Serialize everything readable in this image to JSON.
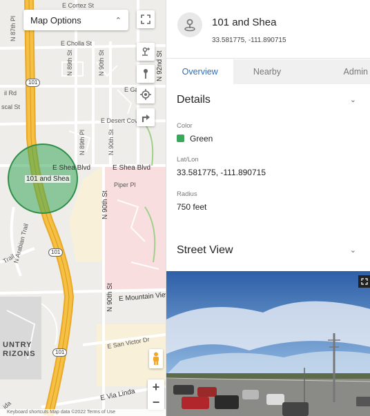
{
  "map": {
    "options_label": "Map Options",
    "roads": {
      "e_cortez_st": "E Cortez St",
      "n_87th_pl": "N 87th Pl",
      "e_cholla_st": "E Cholla St",
      "n_89th_st": "N 89th St",
      "n_90th_st": "N 90th St",
      "n_92nd_st": "N 92nd St",
      "e_ga": "E Ga",
      "il_rd": "il Rd",
      "scal_st": "scal St",
      "e_desert_cove": "E Desert Cove",
      "n_89th_pl": "N 89th Pl",
      "n_90th_st_2": "N 90th St",
      "e_shea_blvd_1": "E Shea Blvd",
      "e_shea_blvd_2": "E Shea Blvd",
      "piper_pl": "Piper Pl",
      "n_90th_st_3": "N 90th St",
      "n_arabian_trail": "N Arabian Trail",
      "trail": "Trail",
      "n_90th_st_4": "N 90th St",
      "e_mountain_view": "E Mountain View",
      "e_san_victor_dr": "E San Victor Dr",
      "e_via_linda": "E Via Linda",
      "ida": "ida"
    },
    "shields": {
      "s1": "101",
      "s2": "101",
      "s3": "101"
    },
    "area_label": [
      "UNTRY",
      "RIZONS"
    ],
    "pin_label": "101 and Shea",
    "footer": "Keyboard shortcuts    Map data ©2022    Terms of Use",
    "colors": {
      "circle": "#3aa85a",
      "freeway": "#f5c043",
      "residential": "#f8d7d7",
      "park": "#cfe7c4"
    }
  },
  "location": {
    "title": "101 and Shea",
    "coords": "33.581775, -111.890715"
  },
  "tabs": [
    {
      "label": "Overview",
      "active": true
    },
    {
      "label": "Nearby",
      "active": false
    },
    {
      "label": "Admin",
      "active": false
    }
  ],
  "details": {
    "title": "Details",
    "color_label": "Color",
    "color_value": "Green",
    "color_hex": "#3aa85a",
    "latlon_label": "Lat/Lon",
    "latlon_value": "33.581775, -111.890715",
    "radius_label": "Radius",
    "radius_value": "750 feet"
  },
  "street_view": {
    "title": "Street View"
  },
  "accent": "#2c6db5"
}
